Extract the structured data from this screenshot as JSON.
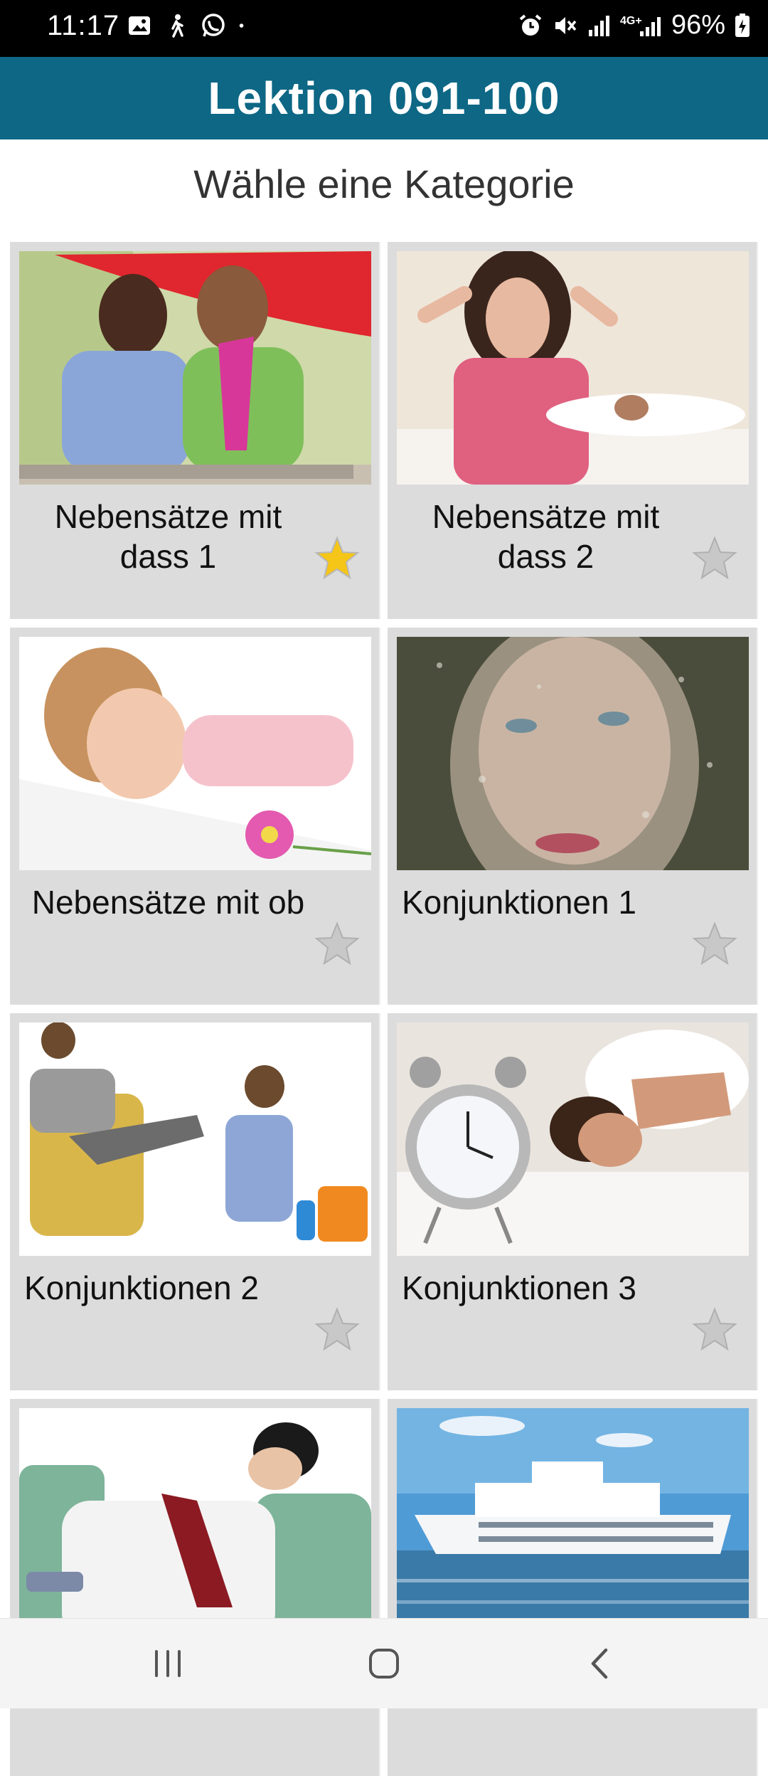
{
  "status_bar": {
    "time": "11:17",
    "battery": "96%",
    "network": "4G+",
    "left_icons": [
      "gallery-icon",
      "walking-icon",
      "whatsapp-icon",
      "dot-icon"
    ],
    "right_icons": [
      "alarm-icon",
      "mute-icon",
      "signal-icon",
      "signal-4g-icon",
      "battery-charging-icon"
    ]
  },
  "header": {
    "title": "Lektion 091-100"
  },
  "page": {
    "subtitle": "Wähle eine Kategorie"
  },
  "categories": [
    {
      "label": "Nebensätze mit dass 1",
      "starred": true
    },
    {
      "label": "Nebensätze mit dass 2",
      "starred": false
    },
    {
      "label": "Nebensätze mit ob",
      "starred": false
    },
    {
      "label": "Konjunktionen 1",
      "starred": false
    },
    {
      "label": "Konjunktionen 2",
      "starred": false
    },
    {
      "label": "Konjunktionen 3",
      "starred": false
    },
    {
      "label": "",
      "starred": false
    },
    {
      "label": "",
      "starred": false
    }
  ],
  "colors": {
    "header": "#0d6785",
    "card": "#dcdcdc",
    "star_active": "#f5c518",
    "star_inactive": "#c8c8c8"
  },
  "nav": {
    "icons": [
      "recent-apps-icon",
      "home-icon",
      "back-icon"
    ]
  }
}
